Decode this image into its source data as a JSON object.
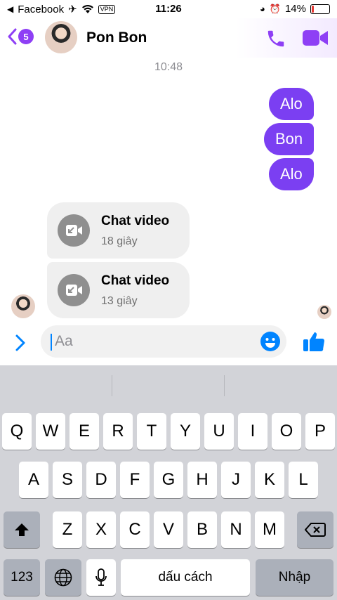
{
  "status_bar": {
    "back_app": "Facebook",
    "time": "11:26",
    "vpn": "VPN",
    "battery": "14%",
    "battery_level": 0.14
  },
  "header": {
    "unread_count": "5",
    "contact_name": "Pon Bon"
  },
  "chat": {
    "timestamp": "10:48",
    "outgoing": [
      {
        "text": "Alo"
      },
      {
        "text": "Bon"
      },
      {
        "text": "Alo"
      }
    ],
    "calls": [
      {
        "title": "Chat video",
        "duration": "18 giây"
      },
      {
        "title": "Chat video",
        "duration": "13 giây"
      }
    ]
  },
  "composer": {
    "placeholder": "Aa"
  },
  "keyboard": {
    "row1": [
      "Q",
      "W",
      "E",
      "R",
      "T",
      "Y",
      "U",
      "I",
      "O",
      "P"
    ],
    "row2": [
      "A",
      "S",
      "D",
      "F",
      "G",
      "H",
      "J",
      "K",
      "L"
    ],
    "row3": [
      "Z",
      "X",
      "C",
      "V",
      "B",
      "N",
      "M"
    ],
    "numbers_key": "123",
    "space_key": "dấu cách",
    "return_key": "Nhập"
  },
  "colors": {
    "accent": "#7b3ff2",
    "messenger_blue": "#0084ff"
  }
}
